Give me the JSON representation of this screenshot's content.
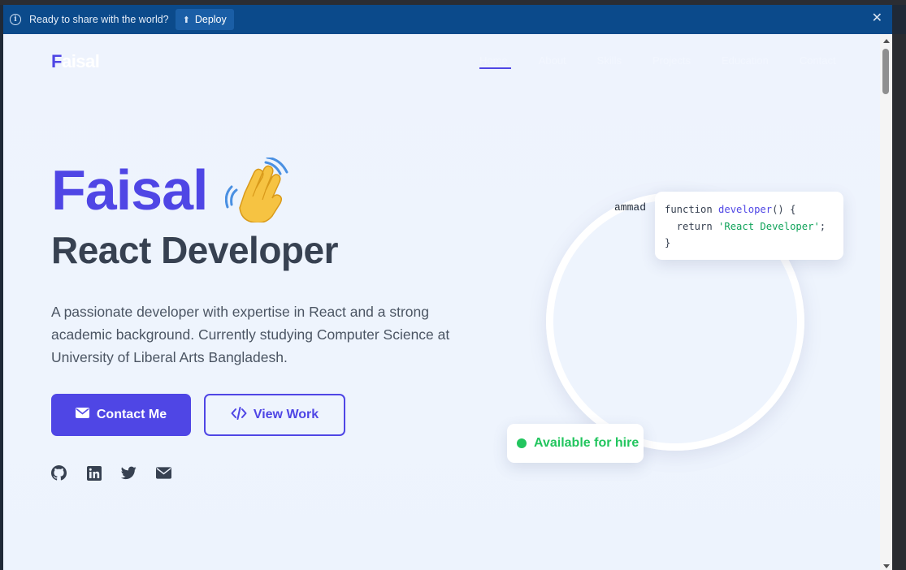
{
  "banner": {
    "message": "Ready to share with the world?",
    "deploy_label": "Deploy"
  },
  "nav": {
    "logo_first": "F",
    "logo_rest": "aisal",
    "links": [
      "Home",
      "About",
      "Skills",
      "Projects",
      "Education",
      "Contact"
    ]
  },
  "hero": {
    "name": "Faisal",
    "wave_emoji": "waving-hand",
    "role": "React Developer",
    "description": "A passionate developer with expertise in React and a strong academic background. Currently studying Computer Science at University of Liberal Arts Bangladesh.",
    "contact_label": "Contact Me",
    "view_work_label": "View Work"
  },
  "socials": [
    "github-icon",
    "linkedin-icon",
    "twitter-icon",
    "email-icon"
  ],
  "illustration": {
    "ring_label": "ammad",
    "code_line1_prefix": "function ",
    "code_line1_fn": "developer",
    "code_line1_suffix": "() {",
    "code_line2_prefix": "  return ",
    "code_line2_str": "'React Developer'",
    "code_line2_suffix": ";",
    "code_line3": "}",
    "hire_label": "Available for hire"
  },
  "colors": {
    "accent": "#4f46e5",
    "banner": "#0b4a8b",
    "success": "#22c55e",
    "heading": "#374151"
  }
}
